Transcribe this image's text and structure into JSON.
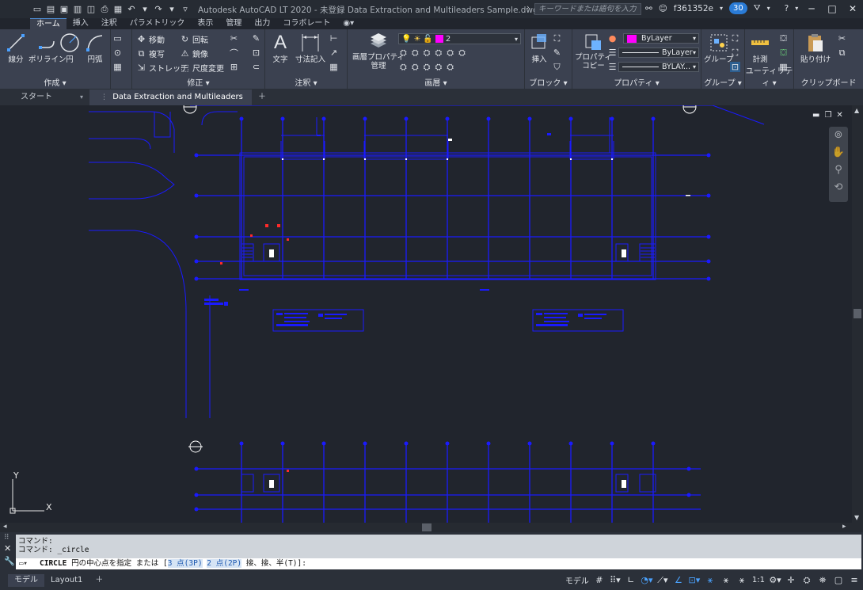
{
  "title": {
    "app_title": "Autodesk AutoCAD LT 2020 - 未登録   Data Extraction and Multileaders Sample.dwg - 読み込み専用",
    "search_placeholder": "キーワードまたは語句を入力",
    "user": "f361352e",
    "notification_count": "30"
  },
  "ribbon_tabs": [
    "ホーム",
    "挿入",
    "注釈",
    "パラメトリック",
    "表示",
    "管理",
    "出力",
    "コラボレート"
  ],
  "panels": {
    "draw": {
      "title": "作成",
      "line": "線分",
      "polyline": "ポリライン",
      "circle": "円",
      "arc": "円弧"
    },
    "modify": {
      "title": "修正",
      "move": "移動",
      "rotate": "回転",
      "copy": "複写",
      "mirror": "鏡像",
      "stretch": "ストレッチ",
      "scale": "尺度変更"
    },
    "annotation": {
      "title": "注釈",
      "text": "文字",
      "dimension": "寸法記入"
    },
    "layers": {
      "title": "画層",
      "layer_props": "画層プロパティ\n管理",
      "current_layer": "2",
      "layer_color": "#ff00ff"
    },
    "block": {
      "title": "ブロック",
      "insert": "挿入"
    },
    "properties": {
      "title": "プロパティ",
      "match": "プロパティ\nコピー",
      "color": "ByLayer",
      "linetype": "ByLayer",
      "lineweight": "BYLAY..."
    },
    "groups": {
      "title": "グループ",
      "group": "グループ"
    },
    "utilities": {
      "title": "ユーティリティ",
      "measure": "計測"
    },
    "clipboard": {
      "title": "クリップボード",
      "paste": "貼り付け"
    }
  },
  "doc_tabs": {
    "start": "スタート",
    "file": "Data Extraction and Multileaders Sample*"
  },
  "command": {
    "history_1": "コマンド:",
    "history_2": "コマンド: _circle",
    "prompt_cmd": "CIRCLE",
    "prompt_text": "円の中心点を指定 または [",
    "opt1": "3 点(3P)",
    "opt2": "2 点(2P)",
    "prompt_tail": "接、接、半(T)]:"
  },
  "status": {
    "model_tab": "モデル",
    "layout_tab": "Layout1",
    "model_label": "モデル",
    "scale": "1:1"
  },
  "ucs": {
    "x": "X",
    "y": "Y"
  },
  "colors": {
    "drawing_blue": "#1a1aff",
    "accent": "#2a7bd6",
    "canvas_bg": "#21252d"
  }
}
